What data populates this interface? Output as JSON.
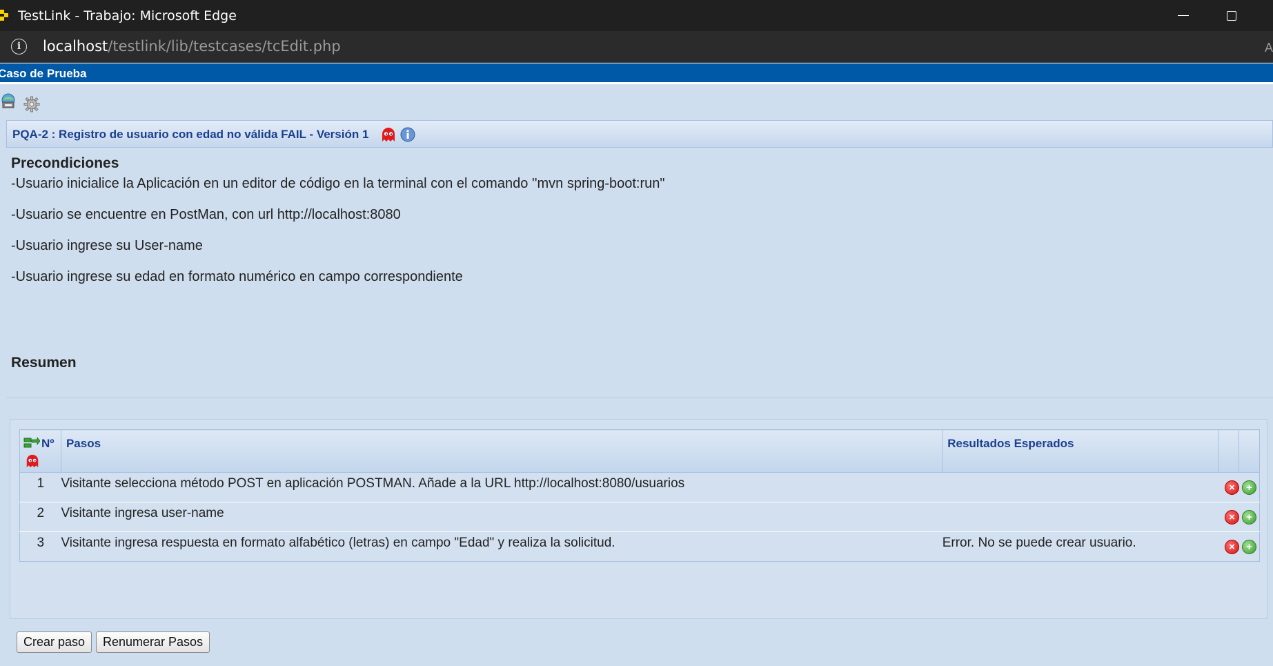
{
  "window": {
    "title": "TestLink - Trabajo: Microsoft Edge"
  },
  "address": {
    "host": "localhost",
    "path": "/testlink/lib/testcases/tcEdit.php",
    "edge_char": "A"
  },
  "page": {
    "header": "Caso de Prueba"
  },
  "testcase": {
    "title": "PQA-2 : Registro de usuario con edad no válida FAIL - Versión 1"
  },
  "preconditions": {
    "heading": "Precondiciones",
    "lines": [
      "-Usuario inicialice la Aplicación en un editor de código en la terminal con el comando ''mvn spring-boot:run\"",
      "-Usuario se encuentre en PostMan, con url http://localhost:8080",
      "-Usuario ingrese su User-name",
      "-Usuario ingrese su edad en formato numérico en campo correspondiente"
    ]
  },
  "summary": {
    "heading": "Resumen"
  },
  "steps_table": {
    "headers": {
      "num": "Nº",
      "steps": "Pasos",
      "expected": "Resultados Esperados"
    },
    "rows": [
      {
        "num": "1",
        "step": "Visitante selecciona método POST en aplicación POSTMAN. Añade a la URL http://localhost:8080/usuarios",
        "expected": ""
      },
      {
        "num": "2",
        "step": "Visitante ingresa user-name",
        "expected": ""
      },
      {
        "num": "3",
        "step": "Visitante ingresa respuesta en formato alfabético (letras) en campo \"Edad\" y realiza la solicitud.",
        "expected": "Error. No se puede crear usuario."
      }
    ]
  },
  "buttons": {
    "create_step": "Crear paso",
    "renumber_steps": "Renumerar Pasos"
  },
  "icons": {
    "app": "testlink-logo-icon",
    "info": "info-icon",
    "print": "print-icon",
    "settings": "gear-icon",
    "ghost": "ghost-icon",
    "delete": "delete-icon",
    "add": "add-icon",
    "reorder": "reorder-icon"
  },
  "colors": {
    "header_blue": "#0059a6",
    "page_bg": "#cfdeee",
    "title_text": "#1b3f8e"
  }
}
